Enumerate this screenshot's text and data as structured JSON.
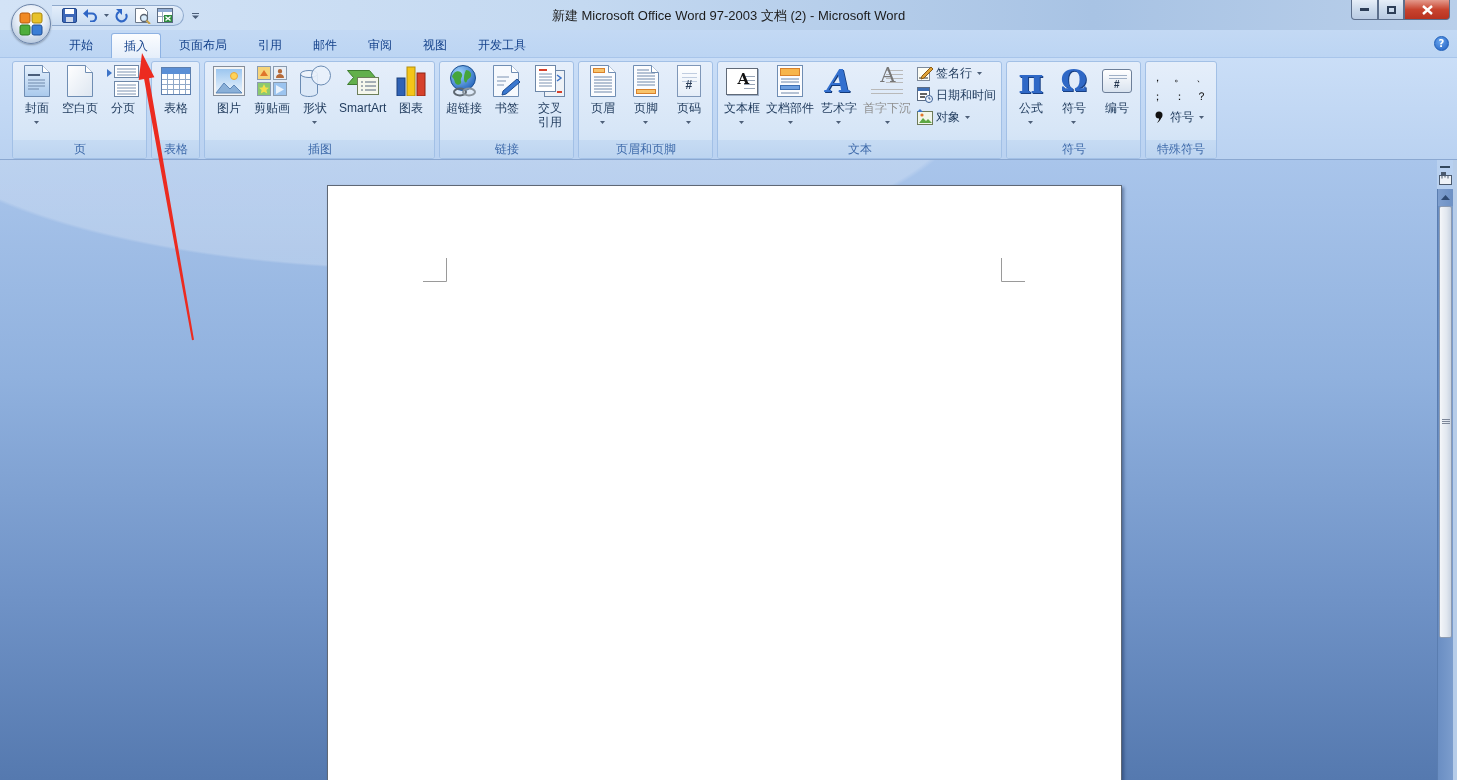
{
  "window": {
    "title": "新建 Microsoft Office Word 97-2003 文档 (2) - Microsoft Word"
  },
  "tabs": [
    {
      "label": "开始",
      "selected": false
    },
    {
      "label": "插入",
      "selected": true
    },
    {
      "label": "页面布局",
      "selected": false
    },
    {
      "label": "引用",
      "selected": false
    },
    {
      "label": "邮件",
      "selected": false
    },
    {
      "label": "审阅",
      "selected": false
    },
    {
      "label": "视图",
      "selected": false
    },
    {
      "label": "开发工具",
      "selected": false
    }
  ],
  "help_button": {
    "label": "?"
  },
  "ribbon": {
    "groups": [
      {
        "label": "页",
        "items": [
          {
            "kind": "large",
            "label": "封面",
            "dropdown": true,
            "disabled": false
          },
          {
            "kind": "large",
            "label": "空白页",
            "dropdown": false,
            "disabled": false
          },
          {
            "kind": "large",
            "label": "分页",
            "dropdown": false,
            "disabled": false
          }
        ]
      },
      {
        "label": "表格",
        "items": [
          {
            "kind": "large",
            "label": "表格",
            "dropdown": false,
            "disabled": false
          }
        ]
      },
      {
        "label": "插图",
        "items": [
          {
            "kind": "large",
            "label": "图片",
            "dropdown": false,
            "disabled": false
          },
          {
            "kind": "large",
            "label": "剪贴画",
            "dropdown": false,
            "disabled": false
          },
          {
            "kind": "large",
            "label": "形状",
            "dropdown": true,
            "disabled": false
          },
          {
            "kind": "large",
            "label": "SmartArt",
            "dropdown": false,
            "disabled": false
          },
          {
            "kind": "large",
            "label": "图表",
            "dropdown": false,
            "disabled": false
          }
        ]
      },
      {
        "label": "链接",
        "items": [
          {
            "kind": "large",
            "label": "超链接",
            "dropdown": false,
            "disabled": false
          },
          {
            "kind": "large",
            "label": "书签",
            "dropdown": false,
            "disabled": false
          },
          {
            "kind": "large",
            "label": [
              "交叉",
              "引用"
            ],
            "dropdown": false,
            "disabled": false
          }
        ]
      },
      {
        "label": "页眉和页脚",
        "items": [
          {
            "kind": "large",
            "label": "页眉",
            "dropdown": true,
            "disabled": false
          },
          {
            "kind": "large",
            "label": "页脚",
            "dropdown": true,
            "disabled": false
          },
          {
            "kind": "large",
            "label": "页码",
            "glyph": "#",
            "dropdown": true,
            "disabled": false
          }
        ]
      },
      {
        "label": "文本",
        "items": [
          {
            "kind": "large",
            "label": "文本框",
            "glyph": "A",
            "dropdown": true,
            "disabled": false
          },
          {
            "kind": "large",
            "label": "文档部件",
            "dropdown": true,
            "disabled": false
          },
          {
            "kind": "large",
            "label": "艺术字",
            "glyph": "A",
            "dropdown": true,
            "disabled": false
          },
          {
            "kind": "large",
            "label": "首字下沉",
            "glyph": "A",
            "dropdown": true,
            "disabled": true
          },
          {
            "kind": "small",
            "label": "签名行",
            "dropdown": true,
            "disabled": false
          },
          {
            "kind": "small",
            "label": "日期和时间",
            "dropdown": false,
            "disabled": false
          },
          {
            "kind": "small",
            "label": "对象",
            "dropdown": true,
            "disabled": false
          }
        ]
      },
      {
        "label": "符号",
        "items": [
          {
            "kind": "large",
            "label": "公式",
            "glyph": "π",
            "dropdown": true,
            "disabled": false
          },
          {
            "kind": "large",
            "label": "符号",
            "glyph": "Ω",
            "dropdown": true,
            "disabled": false
          },
          {
            "kind": "large",
            "label": "编号",
            "glyph": "#",
            "dropdown": false,
            "disabled": false
          }
        ]
      },
      {
        "label": "特殊符号",
        "items": [
          {
            "kind": "symbol",
            "label": "，",
            "dropdown": false,
            "disabled": false
          },
          {
            "kind": "symbol",
            "label": "。",
            "dropdown": false,
            "disabled": false
          },
          {
            "kind": "symbol",
            "label": "、",
            "dropdown": false,
            "disabled": false
          },
          {
            "kind": "symbol",
            "label": "；",
            "dropdown": false,
            "disabled": false
          },
          {
            "kind": "symbol",
            "label": "：",
            "dropdown": false,
            "disabled": false
          },
          {
            "kind": "symbol",
            "label": "？",
            "dropdown": false,
            "disabled": false
          },
          {
            "kind": "small",
            "label": "符号",
            "dropdown": true,
            "disabled": false
          }
        ]
      }
    ]
  }
}
